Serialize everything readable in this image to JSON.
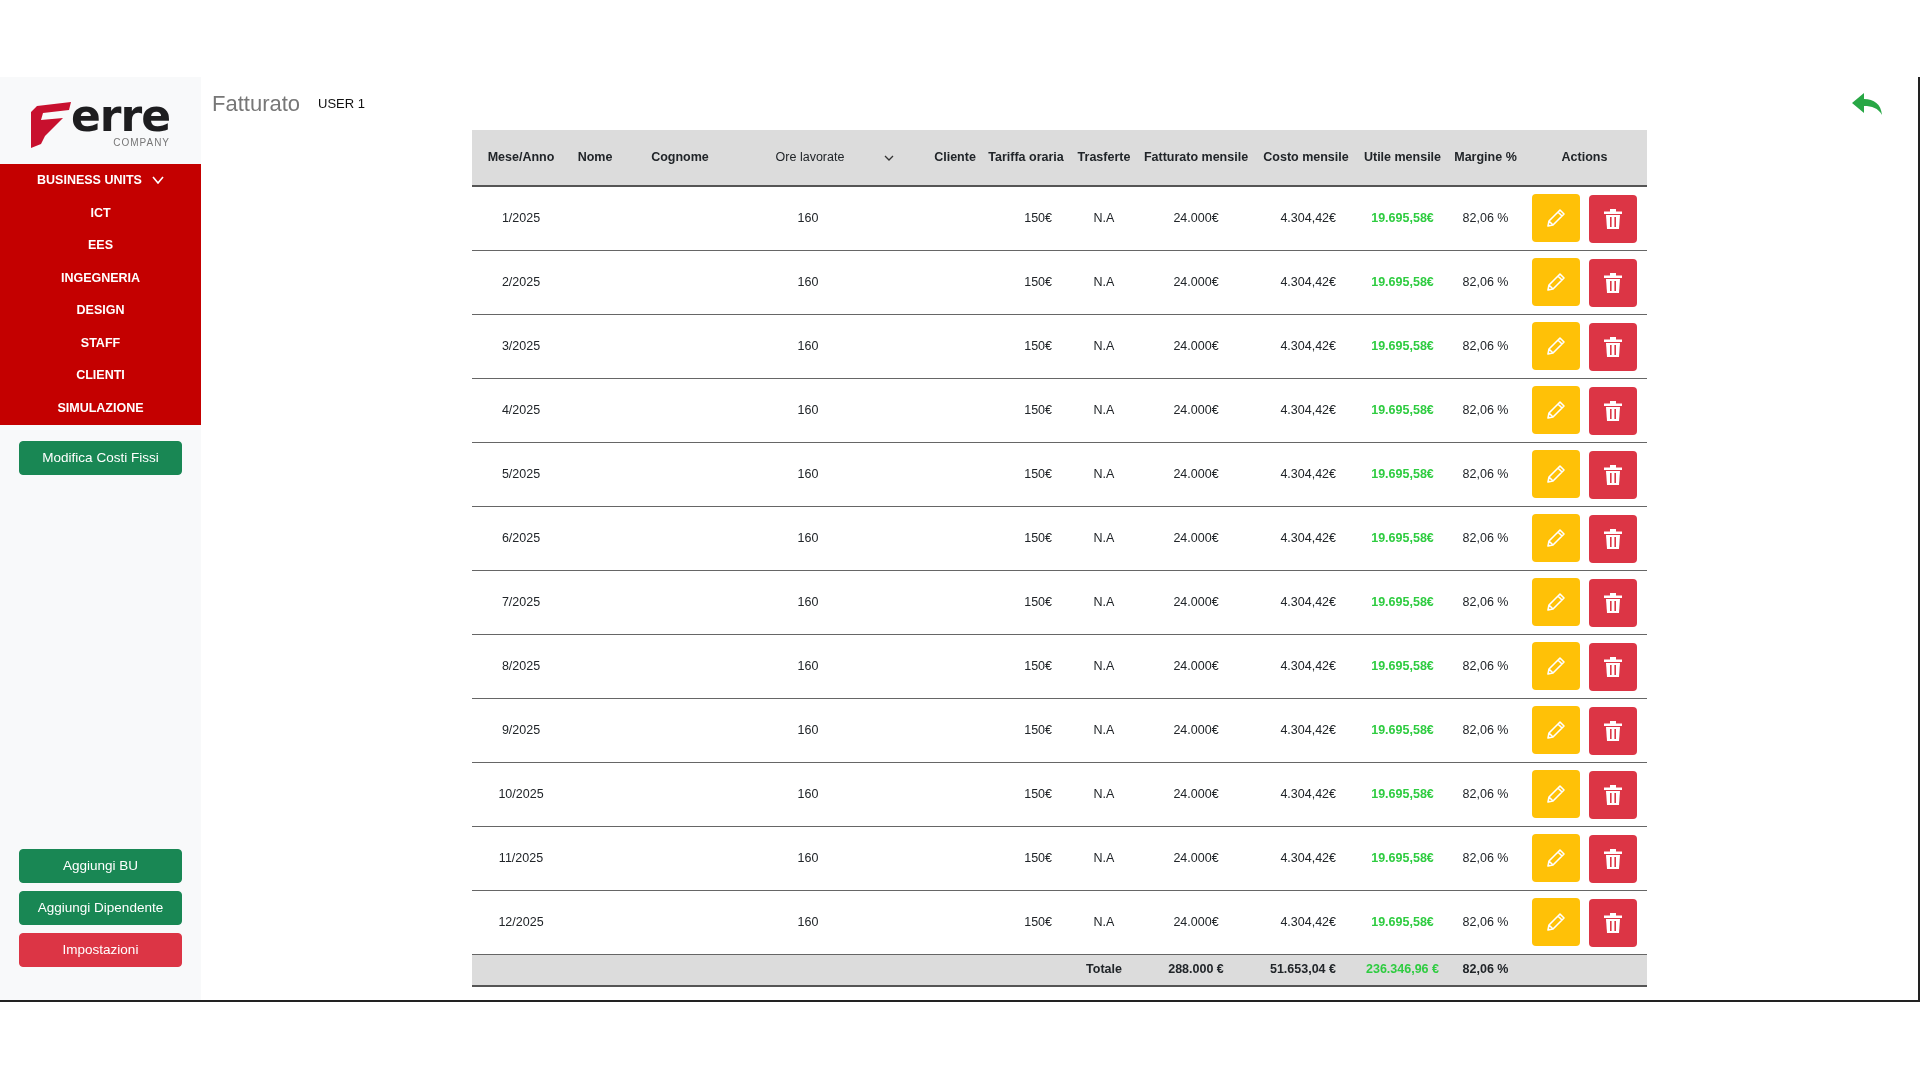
{
  "sidebar": {
    "logo": {
      "wordmark": "erre",
      "subtitle": "COMPANY"
    },
    "menu": {
      "title": "BUSINESS UNITS",
      "expanded": true,
      "items": [
        "ICT",
        "EES",
        "INGEGNERIA",
        "DESIGN",
        "STAFF",
        "CLIENTI",
        "SIMULAZIONE"
      ]
    },
    "top_button": {
      "label": "Modifica Costi Fissi",
      "kind": "success"
    },
    "bottom_buttons": [
      {
        "label": "Aggiungi BU",
        "kind": "success"
      },
      {
        "label": "Aggiungi Dipendente",
        "kind": "success"
      },
      {
        "label": "Impostazioni",
        "kind": "danger"
      }
    ]
  },
  "header": {
    "title": "Fatturato",
    "user": "USER 1"
  },
  "table": {
    "columns": [
      {
        "label": "Mese/Anno",
        "kind": "plain"
      },
      {
        "label": "Nome",
        "kind": "plain"
      },
      {
        "label": "Cognome",
        "kind": "plain"
      },
      {
        "label": "Ore lavorate",
        "kind": "dropdown"
      },
      {
        "label": "Cliente",
        "kind": "plain"
      },
      {
        "label": "Tariffa oraria",
        "kind": "plain"
      },
      {
        "label": "Trasferte",
        "kind": "plain"
      },
      {
        "label": "Fatturato mensile",
        "kind": "plain"
      },
      {
        "label": "Costo mensile",
        "kind": "plain"
      },
      {
        "label": "Utile mensile",
        "kind": "plain"
      },
      {
        "label": "Margine %",
        "kind": "plain"
      },
      {
        "label": "Actions",
        "kind": "plain"
      }
    ],
    "rows": [
      {
        "mese": "1/2025",
        "ore": "160",
        "tariffa": "150€",
        "trasferte": "N.A",
        "fatturato": "24.000€",
        "costo": "4.304,42€",
        "utile": "19.695,58€",
        "margine": "82,06 %"
      },
      {
        "mese": "2/2025",
        "ore": "160",
        "tariffa": "150€",
        "trasferte": "N.A",
        "fatturato": "24.000€",
        "costo": "4.304,42€",
        "utile": "19.695,58€",
        "margine": "82,06 %"
      },
      {
        "mese": "3/2025",
        "ore": "160",
        "tariffa": "150€",
        "trasferte": "N.A",
        "fatturato": "24.000€",
        "costo": "4.304,42€",
        "utile": "19.695,58€",
        "margine": "82,06 %"
      },
      {
        "mese": "4/2025",
        "ore": "160",
        "tariffa": "150€",
        "trasferte": "N.A",
        "fatturato": "24.000€",
        "costo": "4.304,42€",
        "utile": "19.695,58€",
        "margine": "82,06 %"
      },
      {
        "mese": "5/2025",
        "ore": "160",
        "tariffa": "150€",
        "trasferte": "N.A",
        "fatturato": "24.000€",
        "costo": "4.304,42€",
        "utile": "19.695,58€",
        "margine": "82,06 %"
      },
      {
        "mese": "6/2025",
        "ore": "160",
        "tariffa": "150€",
        "trasferte": "N.A",
        "fatturato": "24.000€",
        "costo": "4.304,42€",
        "utile": "19.695,58€",
        "margine": "82,06 %"
      },
      {
        "mese": "7/2025",
        "ore": "160",
        "tariffa": "150€",
        "trasferte": "N.A",
        "fatturato": "24.000€",
        "costo": "4.304,42€",
        "utile": "19.695,58€",
        "margine": "82,06 %"
      },
      {
        "mese": "8/2025",
        "ore": "160",
        "tariffa": "150€",
        "trasferte": "N.A",
        "fatturato": "24.000€",
        "costo": "4.304,42€",
        "utile": "19.695,58€",
        "margine": "82,06 %"
      },
      {
        "mese": "9/2025",
        "ore": "160",
        "tariffa": "150€",
        "trasferte": "N.A",
        "fatturato": "24.000€",
        "costo": "4.304,42€",
        "utile": "19.695,58€",
        "margine": "82,06 %"
      },
      {
        "mese": "10/2025",
        "ore": "160",
        "tariffa": "150€",
        "trasferte": "N.A",
        "fatturato": "24.000€",
        "costo": "4.304,42€",
        "utile": "19.695,58€",
        "margine": "82,06 %"
      },
      {
        "mese": "11/2025",
        "ore": "160",
        "tariffa": "150€",
        "trasferte": "N.A",
        "fatturato": "24.000€",
        "costo": "4.304,42€",
        "utile": "19.695,58€",
        "margine": "82,06 %"
      },
      {
        "mese": "12/2025",
        "ore": "160",
        "tariffa": "150€",
        "trasferte": "N.A",
        "fatturato": "24.000€",
        "costo": "4.304,42€",
        "utile": "19.695,58€",
        "margine": "82,06 %"
      }
    ],
    "totals": {
      "label": "Totale",
      "fatturato": "288.000 €",
      "costo": "51.653,04 €",
      "utile": "236.346,96 €",
      "margine": "82,06 %"
    }
  }
}
